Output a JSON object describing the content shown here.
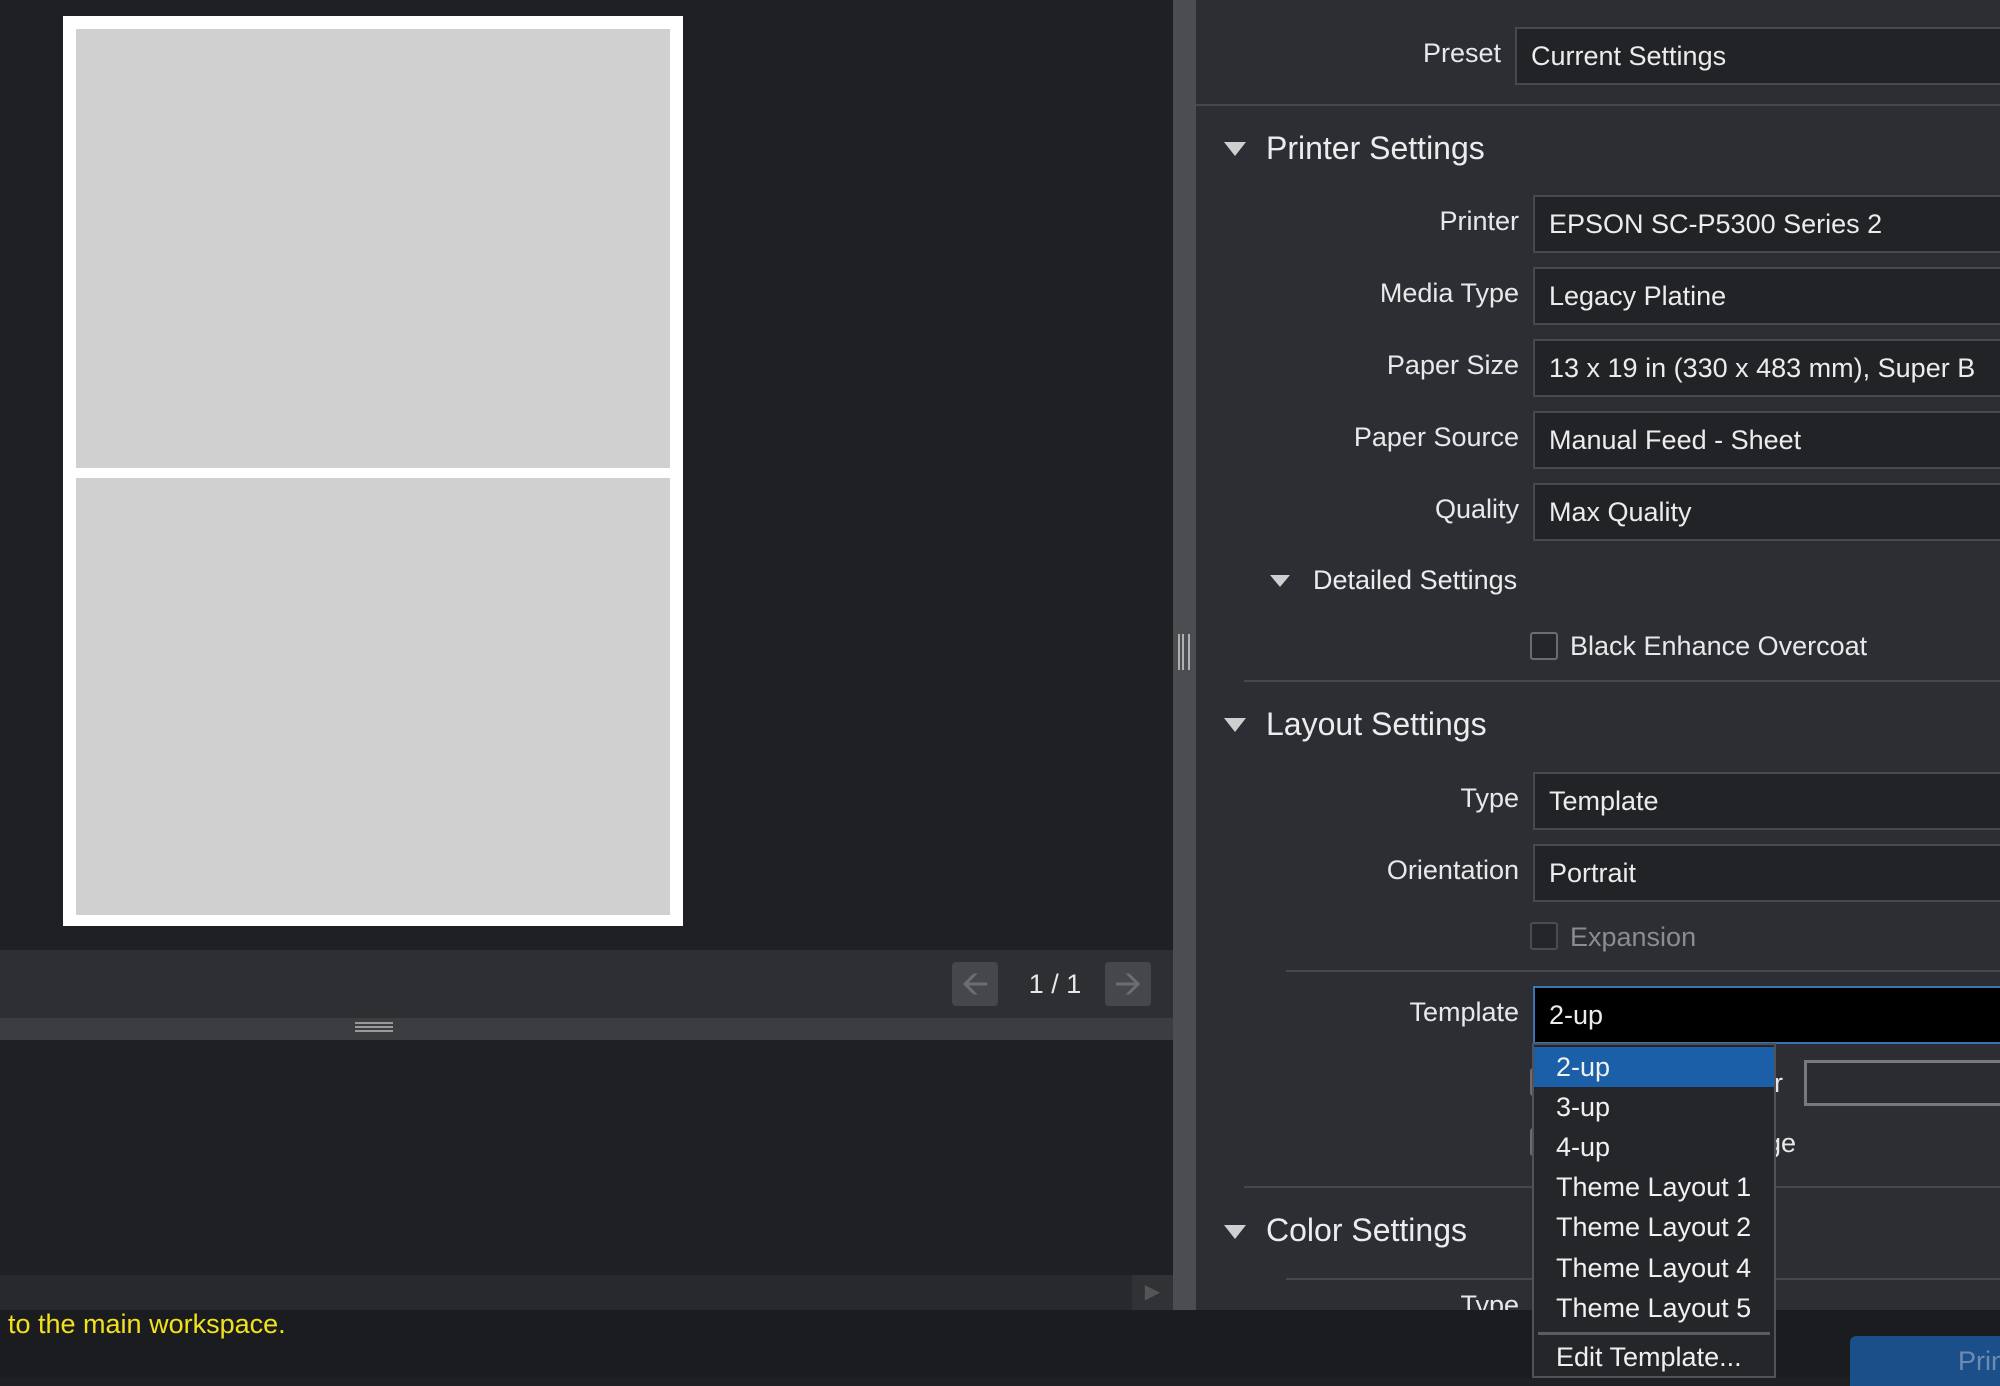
{
  "preview": {
    "page_indicator": "1 / 1",
    "prev_icon": "arrow-left-icon",
    "next_icon": "arrow-right-icon"
  },
  "settings": {
    "preset": {
      "label": "Preset",
      "value": "Current Settings"
    },
    "printer_settings": {
      "title": "Printer Settings",
      "printer": {
        "label": "Printer",
        "value": "EPSON SC-P5300 Series 2"
      },
      "media_type": {
        "label": "Media Type",
        "value": "Legacy Platine"
      },
      "paper_size": {
        "label": "Paper Size",
        "value": "13 x 19 in (330 x 483 mm), Super B"
      },
      "paper_source": {
        "label": "Paper Source",
        "value": "Manual Feed - Sheet"
      },
      "quality": {
        "label": "Quality",
        "value": "Max Quality"
      },
      "detailed_settings": {
        "title": "Detailed Settings",
        "black_enhance_overcoat": {
          "label": "Black Enhance Overcoat",
          "checked": false
        }
      }
    },
    "layout_settings": {
      "title": "Layout Settings",
      "type": {
        "label": "Type",
        "value": "Template"
      },
      "orientation": {
        "label": "Orientation",
        "value": "Portrait"
      },
      "expansion": {
        "label": "Expansion",
        "checked": false,
        "enabled": false
      },
      "template": {
        "label": "Template",
        "value": "2-up"
      },
      "hidden_label_1_fragment": "r",
      "hidden_label_2_fragment": "ge"
    },
    "color_settings": {
      "title": "Color Settings",
      "type_label": "Type"
    }
  },
  "template_dropdown": {
    "options": [
      "2-up",
      "3-up",
      "4-up",
      "Theme Layout 1",
      "Theme Layout 2",
      "Theme Layout 4",
      "Theme Layout 5"
    ],
    "selected": "2-up",
    "edit_label": "Edit Template..."
  },
  "status": {
    "message": "to the main workspace.",
    "print_button": "Print"
  },
  "colors": {
    "accent": "#1b5fa8",
    "status_text": "#f2e21b",
    "panel_bg": "#2c2e33"
  }
}
